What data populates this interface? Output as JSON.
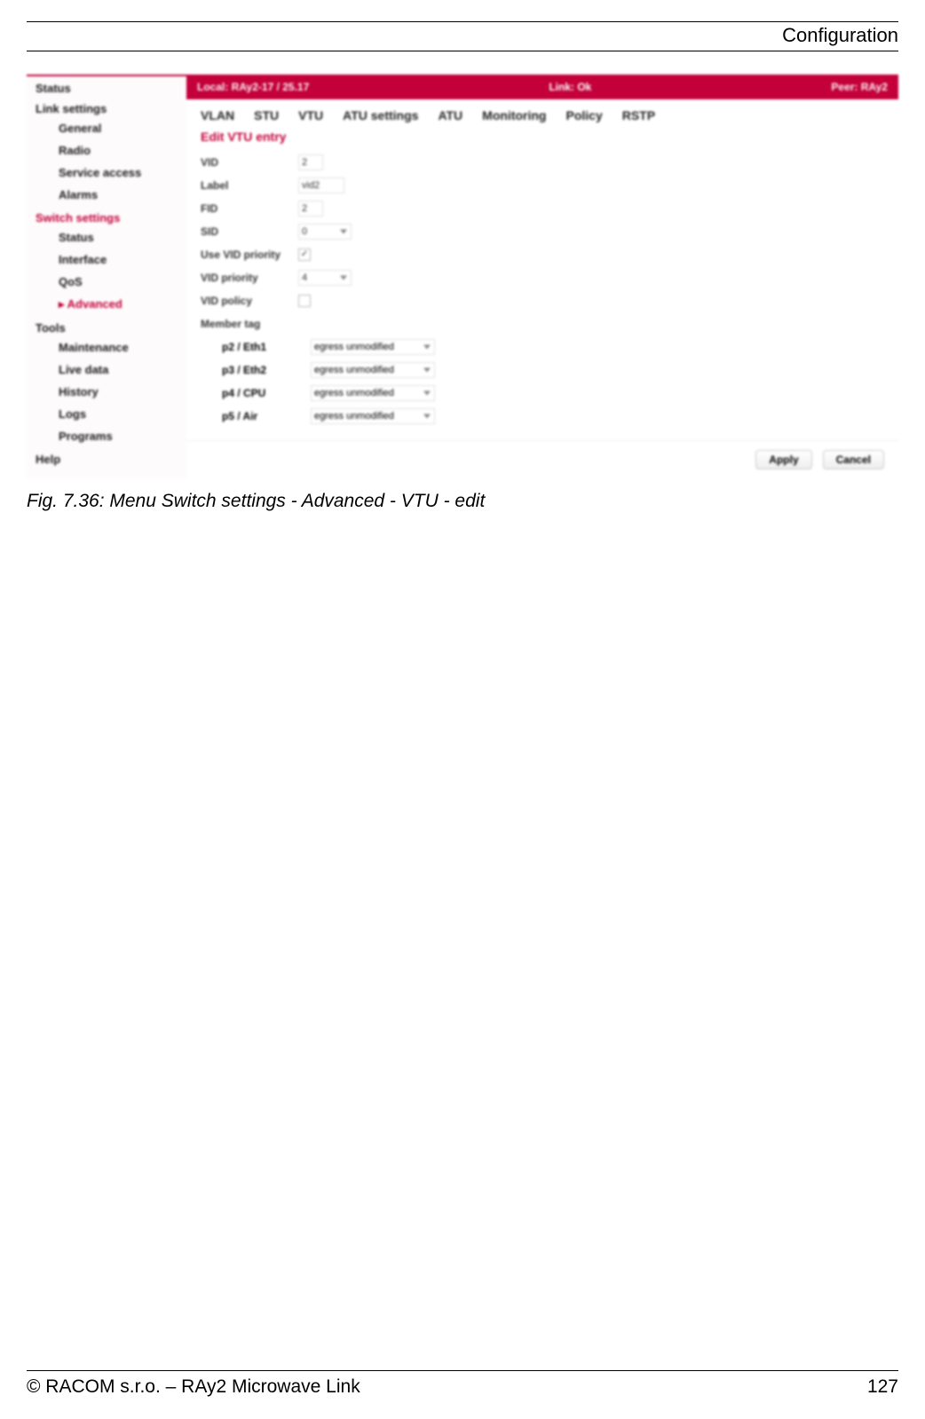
{
  "header": {
    "right_title": "Configuration"
  },
  "sidebar": {
    "groups": [
      {
        "label": "Status",
        "items": []
      },
      {
        "label": "Link settings",
        "items": [
          {
            "label": "General"
          },
          {
            "label": "Radio"
          },
          {
            "label": "Service access"
          },
          {
            "label": "Alarms"
          }
        ]
      },
      {
        "label": "Switch settings",
        "selected": true,
        "items": [
          {
            "label": "Status"
          },
          {
            "label": "Interface"
          },
          {
            "label": "QoS"
          },
          {
            "label": "Advanced",
            "selected": true
          }
        ]
      },
      {
        "label": "Tools",
        "items": [
          {
            "label": "Maintenance"
          },
          {
            "label": "Live data"
          },
          {
            "label": "History"
          },
          {
            "label": "Logs"
          },
          {
            "label": "Programs"
          }
        ]
      },
      {
        "label": "Help",
        "items": []
      }
    ]
  },
  "banner": {
    "left": "Local:  RAy2-17 / 25.17",
    "center": "Link:  Ok",
    "right": "Peer:  RAy2"
  },
  "tabs": [
    "VLAN",
    "STU",
    "VTU",
    "ATU settings",
    "ATU",
    "Monitoring",
    "Policy",
    "RSTP"
  ],
  "section_title": "Edit VTU entry",
  "form": {
    "rows": [
      {
        "label": "VID",
        "value": "2",
        "kind": "text"
      },
      {
        "label": "Label",
        "value": "vid2",
        "kind": "text"
      },
      {
        "label": "FID",
        "value": "2",
        "kind": "text"
      },
      {
        "label": "SID",
        "value": "0",
        "kind": "drop"
      },
      {
        "label": "Use VID priority",
        "value": "✓",
        "kind": "chk"
      },
      {
        "label": "VID priority",
        "value": "4",
        "kind": "drop"
      },
      {
        "label": "VID policy",
        "value": "",
        "kind": "chk"
      },
      {
        "label": "Member tag",
        "value": "",
        "kind": "none"
      }
    ],
    "members": [
      {
        "port": "p2 / Eth1",
        "mode": "egress unmodified"
      },
      {
        "port": "p3 / Eth2",
        "mode": "egress unmodified"
      },
      {
        "port": "p4 / CPU",
        "mode": "egress unmodified"
      },
      {
        "port": "p5 / Air",
        "mode": "egress unmodified"
      }
    ]
  },
  "buttons": {
    "apply": "Apply",
    "cancel": "Cancel"
  },
  "caption": "Fig. 7.36: Menu Switch settings - Advanced - VTU - edit",
  "footer": {
    "left": "© RACOM s.r.o. – RAy2 Microwave Link",
    "right": "127"
  }
}
